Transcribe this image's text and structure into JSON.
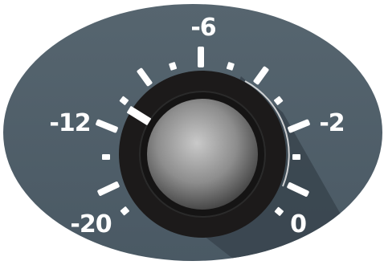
{
  "knob": {
    "name": "gain-knob",
    "colors": {
      "plate": "#4f5f6c",
      "plate_edge": "#3a4650",
      "ring": "#1c1a1a",
      "cap_center": "#c8c8c8",
      "cap_edge": "#3b3b3b",
      "ticks": "#ffffff"
    },
    "scale_labels": {
      "minus_20": "-20",
      "minus_12": "-12",
      "minus_6": "-6",
      "minus_2": "-2",
      "zero": "0"
    },
    "value": "-12"
  }
}
